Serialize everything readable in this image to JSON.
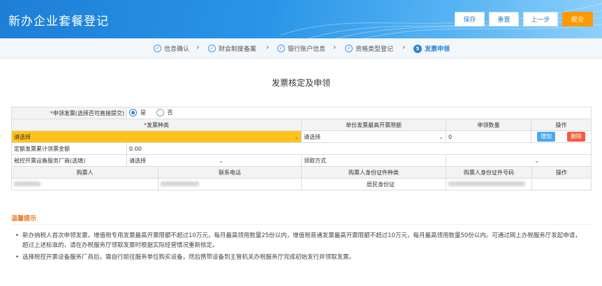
{
  "header": {
    "title": "新办企业套餐登记",
    "buttons": {
      "save": "保存",
      "reset": "重置",
      "prev": "上一步",
      "submit": "提交"
    }
  },
  "steps": [
    {
      "label": "信息确认",
      "state": "done"
    },
    {
      "label": "财会制度备案",
      "state": "done"
    },
    {
      "label": "银行账户信息",
      "state": "done"
    },
    {
      "label": "资格类型登记",
      "state": "done"
    },
    {
      "label": "发票申领",
      "state": "active",
      "num": "5"
    }
  ],
  "section_title": "发票核定及申领",
  "form": {
    "apply_label": "申领发票(选择否可直接提交)",
    "radio_yes": "是",
    "radio_no": "否",
    "col_invoice_type": "发票种类",
    "col_limit": "单份发票最高开票限额",
    "col_qty": "申领数量",
    "col_op": "操作",
    "invoice_type_value": "请选择",
    "limit_value": "请选择",
    "qty_value": "0",
    "btn_add": "增加",
    "btn_del": "删除",
    "fixed_amount_label": "定额发票累计领票金额",
    "fixed_amount_value": "0.00",
    "vendor_label": "税控开票设备服务厂商(选填)",
    "vendor_value": "请选择",
    "receive_label": "领取方式",
    "receive_value": ""
  },
  "buyer_table": {
    "headers": [
      "购票人",
      "联系电话",
      "购票人身份证件种类",
      "购票人身份证件号码",
      "操作"
    ],
    "id_type_value": "居民身份证"
  },
  "tips": {
    "title": "温馨提示",
    "items": [
      "新办纳税人首次申领发票，增值税专用发票最高开票限额不超过10万元，每月最高领用数量25份以内，增值税普通发票最高开票限额不超过10万元，每月最高领用数量50份以内。可通过网上办税服务厅发起申请，超过上述标准的，请在办税服务厅领取发票时根据实际经营情况重新核定。",
      "选择税控开票设备服务厂商后，需自行前往服务单位购买设备，然后携带设备到主管机关办税服务厅完成初始发行并领取发票。"
    ]
  },
  "colors": {
    "accent": "#2a83d2",
    "submit": "#ff9900",
    "highlight": "#ffc21a",
    "delete": "#f55a3c"
  }
}
